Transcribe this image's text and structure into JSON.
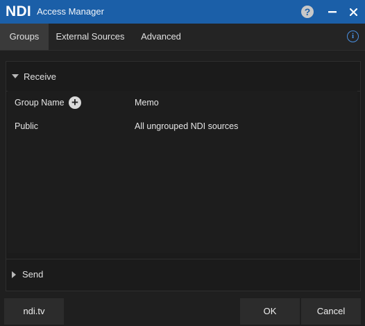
{
  "window": {
    "logo_text": "NDI",
    "title": "Access Manager",
    "help_symbol": "?",
    "minimize_symbol": "—",
    "close_symbol": "✕"
  },
  "tabs": [
    {
      "label": "Groups",
      "active": true
    },
    {
      "label": "External Sources",
      "active": false
    },
    {
      "label": "Advanced",
      "active": false
    }
  ],
  "info_symbol": "i",
  "receive": {
    "label": "Receive",
    "expanded": true,
    "columns": {
      "group_name": "Group Name",
      "memo": "Memo"
    },
    "add_symbol": "+",
    "rows": [
      {
        "group_name": "Public",
        "memo": "All ungrouped NDI sources"
      }
    ]
  },
  "send": {
    "label": "Send",
    "expanded": false
  },
  "footer": {
    "link_label": "ndi.tv",
    "ok_label": "OK",
    "cancel_label": "Cancel"
  },
  "colors": {
    "titlebar": "#1b5fa8",
    "background": "#1f1f1f",
    "accent_info": "#4a90e2"
  }
}
